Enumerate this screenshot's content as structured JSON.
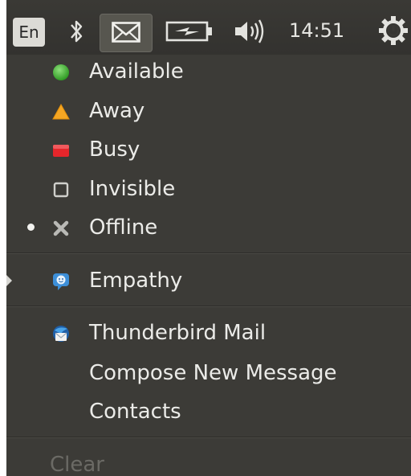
{
  "panel": {
    "language": "En",
    "clock": "14:51",
    "icons": [
      "bluetooth-icon",
      "mail-icon",
      "battery-icon",
      "volume-icon",
      "session-gear-icon"
    ]
  },
  "status": {
    "items": [
      {
        "label": "Available",
        "icon": "available-status-icon",
        "color": "#4caf3c"
      },
      {
        "label": "Away",
        "icon": "away-status-icon",
        "color": "#f5a623"
      },
      {
        "label": "Busy",
        "icon": "busy-status-icon",
        "color": "#e5262b"
      },
      {
        "label": "Invisible",
        "icon": "invisible-status-icon",
        "color": "#cfcfcb"
      },
      {
        "label": "Offline",
        "icon": "offline-status-icon",
        "color": "#b9b9b5",
        "selected": true
      }
    ]
  },
  "apps": {
    "empathy": {
      "label": "Empathy",
      "icon": "empathy-icon"
    },
    "thunderbird": {
      "label": "Thunderbird Mail",
      "icon": "thunderbird-icon"
    },
    "compose": "Compose New Message",
    "contacts": "Contacts"
  },
  "clear_label": "Clear",
  "colors": {
    "panel_bg": "#3c3b37",
    "menu_text": "#ebebe8",
    "disabled_text": "#6b6a65"
  }
}
